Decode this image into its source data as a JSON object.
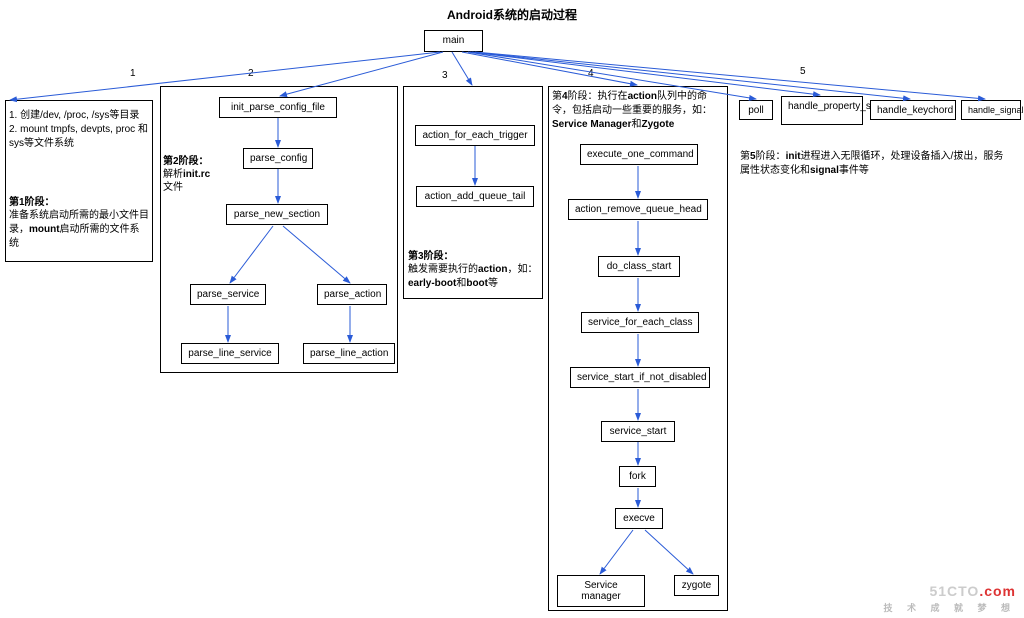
{
  "title": "Android系统的启动过程",
  "main": "main",
  "edge_labels": [
    "1",
    "2",
    "3",
    "4",
    "5"
  ],
  "phase1": {
    "note1": "1. 创建/dev, /proc, /sys等目录",
    "note2": "2. mount  tmpfs, devpts, proc 和sys等文件系统",
    "note3": "第1阶段：",
    "note4": "准备系统启动所需的最小文件目录，mount启动所需的文件系统"
  },
  "phase2": {
    "note1": "第2阶段：",
    "note2": "解析init.rc",
    "note3": "文件",
    "n1": "init_parse_config_file",
    "n2": "parse_config",
    "n3": "parse_new_section",
    "n4": "parse_service",
    "n5": "parse_action",
    "n6": "parse_line_service",
    "n7": "parse_line_action"
  },
  "phase3": {
    "n1": "action_for_each_trigger",
    "n2": "action_add_queue_tail",
    "note1": "第3阶段：",
    "note2": "触发需要执行的action，如：early-boot和boot等"
  },
  "phase4": {
    "note1": "第4阶段：执行在action队列中的命令，包括启动一些重要的服务，如：Service Manager和Zygote",
    "n1": "execute_one_command",
    "n2": "action_remove_queue_head",
    "n3": "do_class_start",
    "n4": "service_for_each_class",
    "n5": "service_start_if_not_disabled",
    "n6": "service_start",
    "n7": "fork",
    "n8": "execve",
    "n9": "Service manager",
    "n10": "zygote"
  },
  "phase5": {
    "n1": "poll",
    "n2": "handle_property_set_fd",
    "n3": "handle_keychord",
    "n4": "handle_signal",
    "note1": "第5阶段：init进程进入无限循环，处理设备插入/拔出，服务属性状态变化和signal事件等"
  },
  "watermark": {
    "main1": "51CTO",
    "main2": ".com",
    "sub": "技 术 成 就 梦 想"
  }
}
